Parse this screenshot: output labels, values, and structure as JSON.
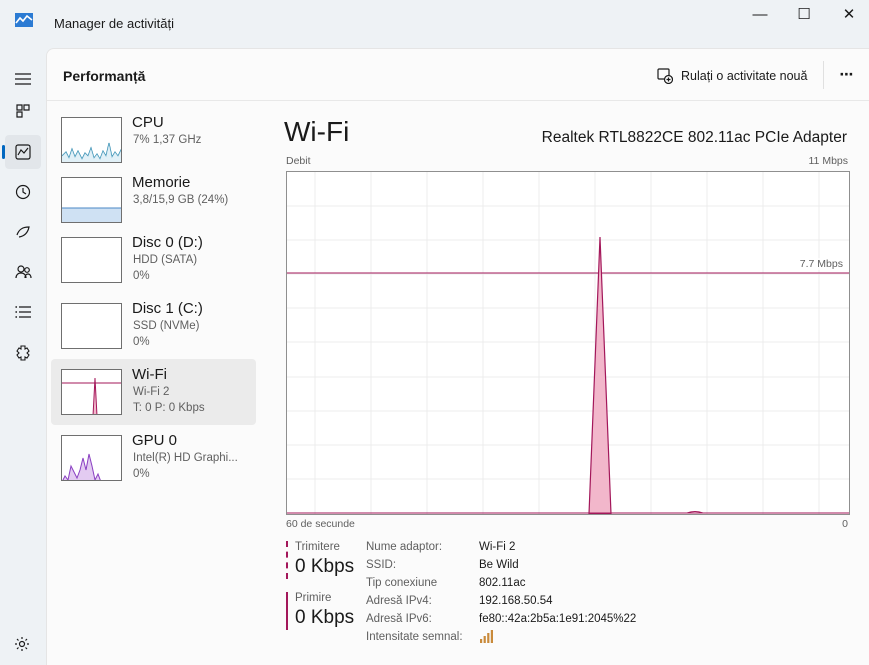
{
  "window": {
    "title": "Manager de activități",
    "minimize_glyph": "—",
    "maximize_glyph": "☐",
    "close_glyph": "✕"
  },
  "nav": [
    {
      "name": "hamburger-menu-icon"
    },
    {
      "name": "processes-icon"
    },
    {
      "name": "performance-icon",
      "active": true
    },
    {
      "name": "app-history-icon"
    },
    {
      "name": "startup-apps-icon"
    },
    {
      "name": "users-icon"
    },
    {
      "name": "details-icon"
    },
    {
      "name": "services-icon"
    }
  ],
  "header": {
    "title": "Performanță",
    "run_task_label": "Rulați o activitate nouă",
    "more_label": "⋯"
  },
  "devices": [
    {
      "name": "CPU",
      "line1": "7%  1,37 GHz",
      "line2": ""
    },
    {
      "name": "Memorie",
      "line1": "3,8/15,9 GB (24%)",
      "line2": ""
    },
    {
      "name": "Disc 0 (D:)",
      "line1": "HDD (SATA)",
      "line2": "0%"
    },
    {
      "name": "Disc 1 (C:)",
      "line1": "SSD (NVMe)",
      "line2": "0%"
    },
    {
      "name": "Wi-Fi",
      "line1": "Wi-Fi 2",
      "line2": "T: 0  P: 0 Kbps",
      "selected": true
    },
    {
      "name": "GPU 0",
      "line1": "Intel(R) HD Graphi...",
      "line2": "0%"
    }
  ],
  "detail": {
    "title": "Wi-Fi",
    "adapter": "Realtek RTL8822CE 802.11ac PCIe Adapter",
    "y_label": "Debit",
    "y_max_label": "11 Mbps",
    "ref_line_label": "7.7 Mbps",
    "x_left_label": "60 de secunde",
    "x_right_label": "0"
  },
  "stats": {
    "send_label": "Trimitere",
    "send_value": "0 Kbps",
    "receive_label": "Primire",
    "receive_value": "0 Kbps"
  },
  "properties": [
    {
      "key": "Nume adaptor:",
      "value": "Wi-Fi 2"
    },
    {
      "key": "SSID:",
      "value": "Be Wild"
    },
    {
      "key": "Tip conexiune",
      "value": "802.11ac"
    },
    {
      "key": "Adresă IPv4:",
      "value": "192.168.50.54"
    },
    {
      "key": "Adresă IPv6:",
      "value": "fe80::42a:2b5a:1e91:2045%22"
    },
    {
      "key": "Intensitate semnal:",
      "value": ""
    }
  ],
  "signal_strength_bars": 4,
  "colors": {
    "accent": "#0067c0",
    "wifi_line": "#a3175a",
    "wifi_fill": "#f2b7cb",
    "cpu_line": "#1a7fa8",
    "memory_fill": "#cfe1f3",
    "gpu_line": "#8a3fc2"
  }
}
